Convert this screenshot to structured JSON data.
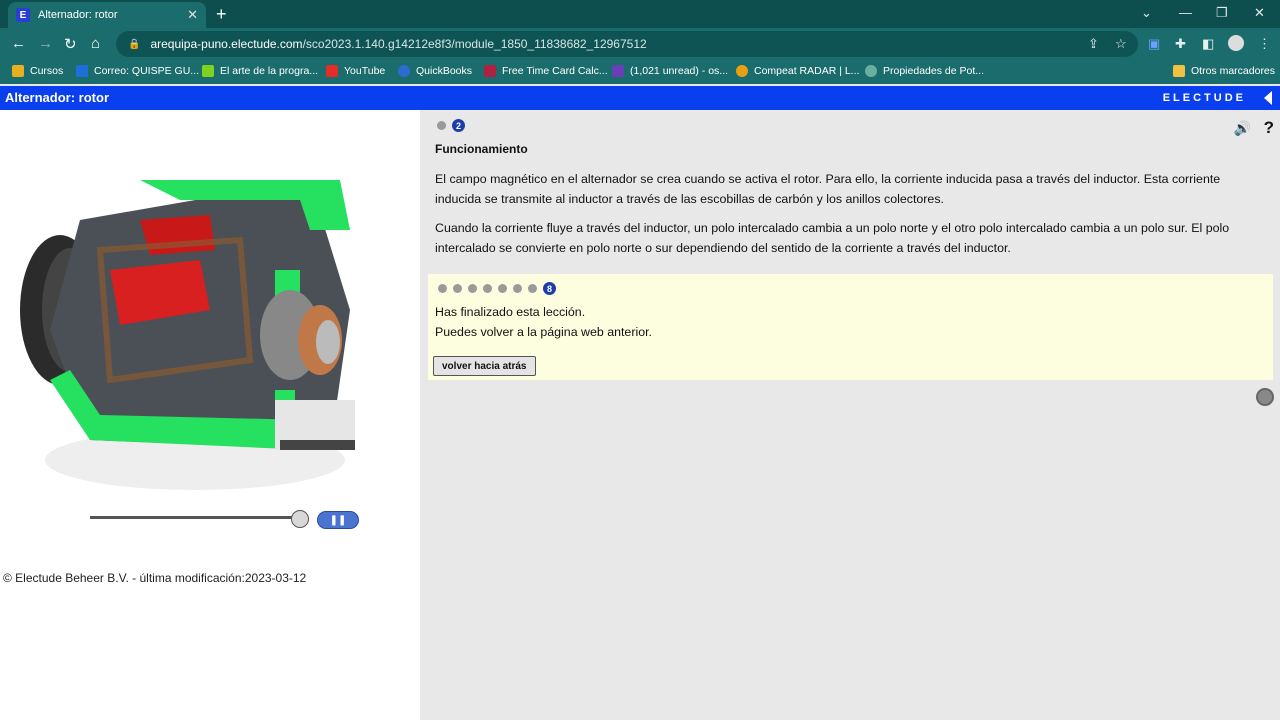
{
  "browser": {
    "tab_title": "Alternador: rotor",
    "tab_favicon": "E",
    "url_host": "arequipa-puno.electude.com",
    "url_path": "/sco2023.1.140.g14212e8f3/module_1850_11838682_12967512",
    "bookmarks": [
      {
        "label": "Cursos",
        "color": "#e8b020"
      },
      {
        "label": "Correo: QUISPE GU...",
        "color": "#1e6fd9"
      },
      {
        "label": "El arte de la progra...",
        "color": "#7ed321"
      },
      {
        "label": "YouTube",
        "color": "#e52d27"
      },
      {
        "label": "QuickBooks",
        "color": "#2c6ccf"
      },
      {
        "label": "Free Time Card Calc...",
        "color": "#b02040"
      },
      {
        "label": "(1,021 unread) - os...",
        "color": "#6a3fb5"
      },
      {
        "label": "Compeat RADAR | L...",
        "color": "#e8a010"
      },
      {
        "label": "Propiedades de Pot...",
        "color": "#6ab0a0"
      }
    ],
    "other_bookmarks": "Otros marcadores"
  },
  "app": {
    "title": "Alternador: rotor",
    "brand": "ELECTUDE"
  },
  "left": {
    "slider_progress": 1.0,
    "copyright": "© Electude Beheer B.V. - última modificación:2023-03-12"
  },
  "right": {
    "top_step_current": "2",
    "section_title": "Funcionamiento",
    "paragraph1": "El campo magnético en el alternador se crea cuando se activa el rotor. Para ello, la corriente inducida pasa a través del inductor. Esta corriente inducida se transmite al inductor a través de las escobillas de carbón y los anillos colectores.",
    "paragraph2": "Cuando la corriente fluye a través del inductor, un polo intercalado cambia a un polo norte y el otro polo intercalado cambia a un polo sur. El polo intercalado se convierte en polo norte o sur dependiendo del sentido de la corriente a través del inductor.",
    "notice_step_current": "8",
    "notice_line1": "Has finalizado esta lección.",
    "notice_line2": "Puedes volver a la página web anterior.",
    "back_button": "volver hacia atrás"
  }
}
